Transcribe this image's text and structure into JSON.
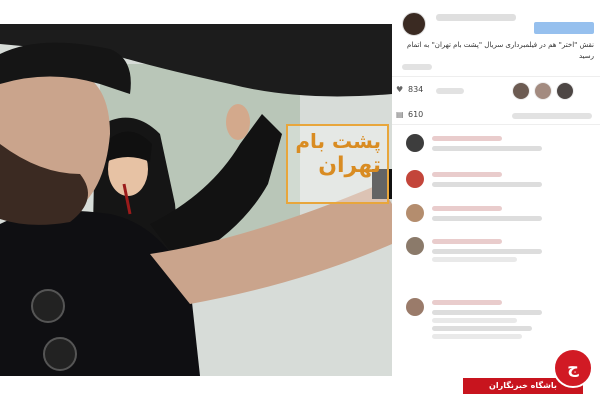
{
  "post": {
    "caption": "نقش \"اختر\" هم در فیلمبرداری سریال \"پشت بام تهران\" به اتمام رسید",
    "likes_count": "834",
    "comments_count": "610",
    "image_overlay": {
      "line1": "پشت بام",
      "line2": "تهران"
    }
  },
  "badge": {
    "label": "باشگاه خبرنگاران",
    "icon": "news-agency-logo-icon"
  },
  "icons": {
    "like": "heart-icon",
    "comment": "comment-icon"
  },
  "colors": {
    "badge_red": "#c8141e",
    "overlay_orange": "#d98c22",
    "follow_blue": "#3f8ce0"
  }
}
